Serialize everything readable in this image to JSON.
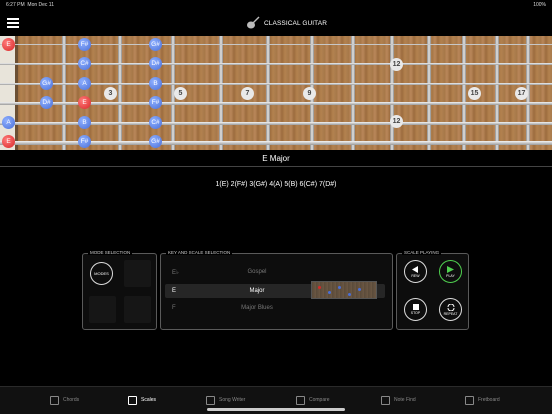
{
  "status": {
    "time": "6:27 PM",
    "date": "Mon Dec 11",
    "battery": "100%"
  },
  "header": {
    "title": "CLASSICAL GUITAR",
    "menu_icon": "hamburger-icon",
    "logo_icon": "guitar-icon"
  },
  "fretboard": {
    "fret_markers": [
      "3",
      "5",
      "7",
      "9",
      "12",
      "15",
      "17"
    ],
    "notes_row1": [
      "E",
      "F#",
      "G#"
    ],
    "notes_row2": [
      "C#",
      "D#"
    ],
    "notes_row3": [
      "G#",
      "A",
      "B"
    ],
    "notes_row4": [
      "D#",
      "E",
      "F#"
    ],
    "notes_row5": [
      "A",
      "B",
      "C#"
    ],
    "notes_row6": [
      "E",
      "F#",
      "G#"
    ],
    "open_notes": [
      "E",
      "A",
      "E"
    ]
  },
  "scale": {
    "name": "E Major",
    "degrees": "1(E)  2(F#)  3(G#)  4(A)  5(B)  6(C#)  7(D#)"
  },
  "mode_selection": {
    "label": "MODE SELECTION",
    "button": "MODES"
  },
  "key_scale": {
    "label": "KEY AND SCALE SELECTION",
    "rows": [
      {
        "key": "E♭",
        "scale": "Gospel"
      },
      {
        "key": "E",
        "scale": "Major"
      },
      {
        "key": "F",
        "scale": "Major Blues"
      }
    ]
  },
  "scale_playing": {
    "label": "SCALE PLAYING",
    "rew": "REW",
    "play": "PLAY",
    "stop": "STOP",
    "repeat": "REPEAT"
  },
  "tabs": [
    "Chords",
    "Scales",
    "Song Writer",
    "Compare",
    "Note Find",
    "Fretboard"
  ],
  "colors": {
    "root": "#d82828",
    "note": "#4a6fd8",
    "play": "#4fd04f"
  }
}
